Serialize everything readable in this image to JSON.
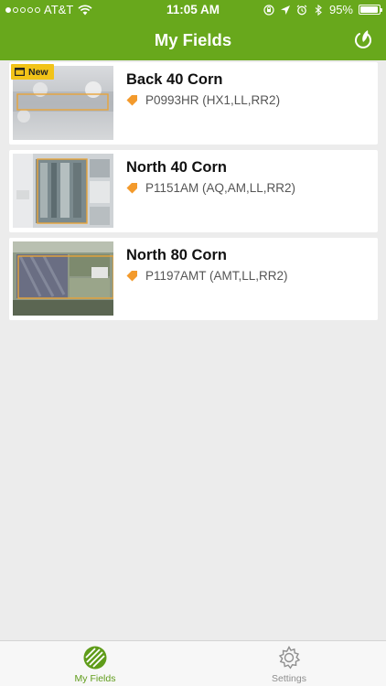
{
  "status": {
    "carrier": "AT&T",
    "time": "11:05 AM",
    "battery": "95%",
    "battery_level": 0.95,
    "signal_bars_filled": 1,
    "signal_bars_total": 5
  },
  "header": {
    "title": "My Fields",
    "color": "#68a81c"
  },
  "fields": [
    {
      "name": "Back 40 Corn",
      "seed": "P0993HR (HX1,LL,RR2)",
      "badge": "New"
    },
    {
      "name": "North 40 Corn",
      "seed": "P1151AM (AQ,AM,LL,RR2)"
    },
    {
      "name": "North 80 Corn",
      "seed": "P1197AMT (AMT,LL,RR2)"
    }
  ],
  "tabs": [
    {
      "label": "My Fields",
      "icon": "field-icon",
      "active": true
    },
    {
      "label": "Settings",
      "icon": "gear-icon",
      "active": false
    }
  ],
  "colors": {
    "accent": "#68a81c",
    "badge": "#f2c318",
    "seed": "#f39a2c",
    "boundary": "#e8a43a"
  }
}
